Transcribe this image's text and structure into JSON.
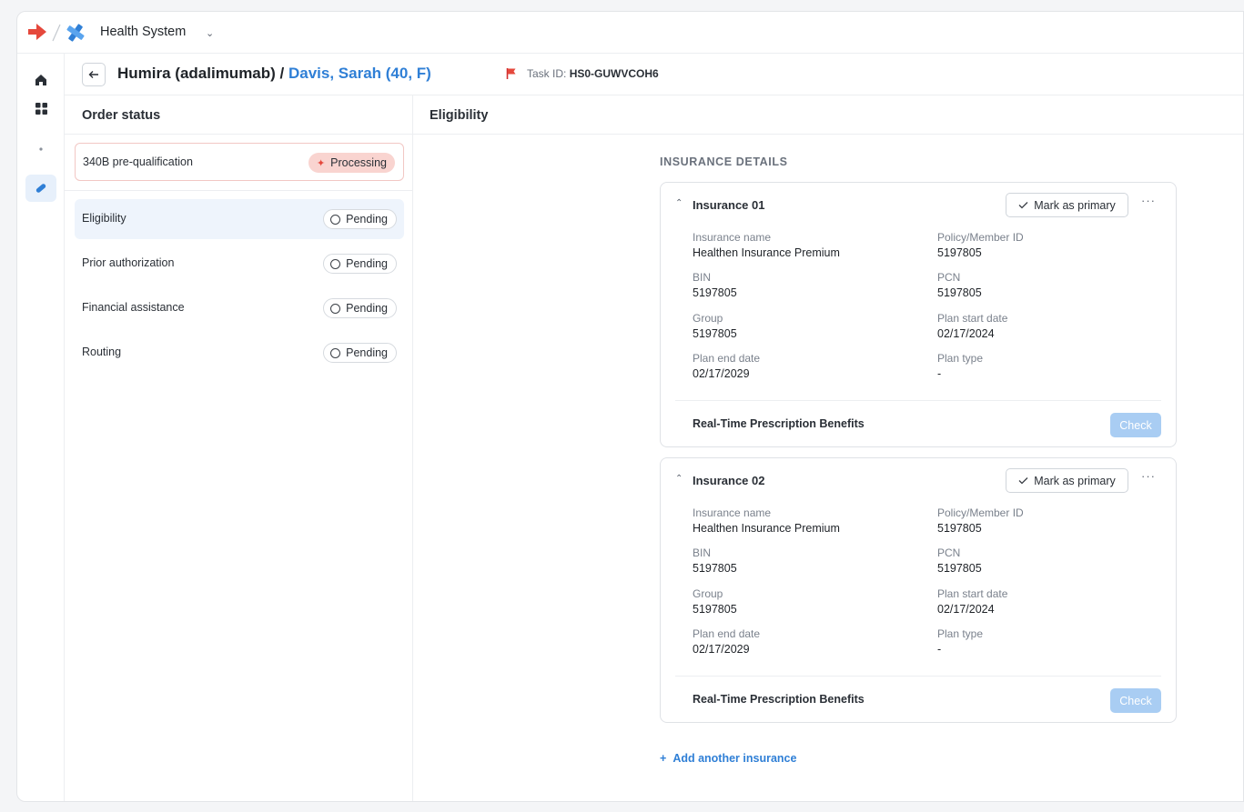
{
  "app": {
    "org_name": "Health System",
    "brand_color": "#e5483c",
    "accent_color": "#2f7fd6"
  },
  "rail": {
    "items": [
      {
        "icon": "home-icon"
      },
      {
        "icon": "grid-icon"
      },
      {
        "icon": "dot-icon"
      },
      {
        "icon": "pill-icon",
        "active": true
      }
    ]
  },
  "header": {
    "drug": "Humira (adalimumab)",
    "separator": " / ",
    "patient": "Davis, Sarah (40, F)",
    "task_label": "Task ID:",
    "task_id": "HS0-GUWVCOH6"
  },
  "order_status": {
    "title": "Order status",
    "prequal": {
      "label": "340B pre-qualification",
      "status": "Processing"
    },
    "steps": [
      {
        "label": "Eligibility",
        "status": "Pending",
        "active": true
      },
      {
        "label": "Prior authorization",
        "status": "Pending"
      },
      {
        "label": "Financial assistance",
        "status": "Pending"
      },
      {
        "label": "Routing",
        "status": "Pending"
      }
    ]
  },
  "main": {
    "title": "Eligibility",
    "section_label": "INSURANCE DETAILS",
    "mark_primary_label": "Mark as primary",
    "more_label": "···",
    "rtpb_label": "Real-Time Prescription Benefits",
    "check_label": "Check",
    "add_label": "Add another insurance",
    "add_icon": "+",
    "field_labels": {
      "insurance_name": "Insurance name",
      "policy_id": "Policy/Member ID",
      "bin": "BIN",
      "pcn": "PCN",
      "group": "Group",
      "plan_start": "Plan start date",
      "plan_end": "Plan end date",
      "plan_type": "Plan type"
    },
    "insurances": [
      {
        "title": "Insurance 01",
        "insurance_name": "Healthen Insurance Premium",
        "policy_id": "5197805",
        "bin": "5197805",
        "pcn": "5197805",
        "group": "5197805",
        "plan_start": "02/17/2024",
        "plan_end": "02/17/2029",
        "plan_type": "-"
      },
      {
        "title": "Insurance 02",
        "insurance_name": "Healthen Insurance Premium",
        "policy_id": "5197805",
        "bin": "5197805",
        "pcn": "5197805",
        "group": "5197805",
        "plan_start": "02/17/2024",
        "plan_end": "02/17/2029",
        "plan_type": "-"
      }
    ]
  }
}
